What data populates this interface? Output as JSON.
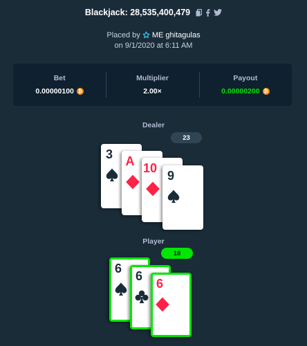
{
  "header": {
    "title": "Blackjack: 28,535,400,479"
  },
  "placed": {
    "prefix": "Placed by",
    "username": "ME ghitagulas",
    "date_line": "on 9/1/2020 at 6:11 AM"
  },
  "stats": {
    "bet_label": "Bet",
    "bet_value": "0.00000100",
    "multiplier_label": "Multiplier",
    "multiplier_value": "2.00×",
    "payout_label": "Payout",
    "payout_value": "0.00000200",
    "currency_icon": "bitcoin-icon",
    "currency_symbol": "₿"
  },
  "dealer": {
    "label": "Dealer",
    "score": "23",
    "cards": [
      {
        "rank": "3",
        "suit": "spade"
      },
      {
        "rank": "A",
        "suit": "diamond"
      },
      {
        "rank": "10",
        "suit": "diamond"
      },
      {
        "rank": "9",
        "suit": "spade"
      }
    ]
  },
  "player": {
    "label": "Player",
    "score": "18",
    "cards": [
      {
        "rank": "6",
        "suit": "spade"
      },
      {
        "rank": "6",
        "suit": "club"
      },
      {
        "rank": "6",
        "suit": "diamond"
      }
    ]
  },
  "colors": {
    "background": "#1a2c38",
    "panel": "#0f212e",
    "win_green": "#00e701",
    "red_suit": "#fe2247",
    "bitcoin": "#f7931a"
  }
}
